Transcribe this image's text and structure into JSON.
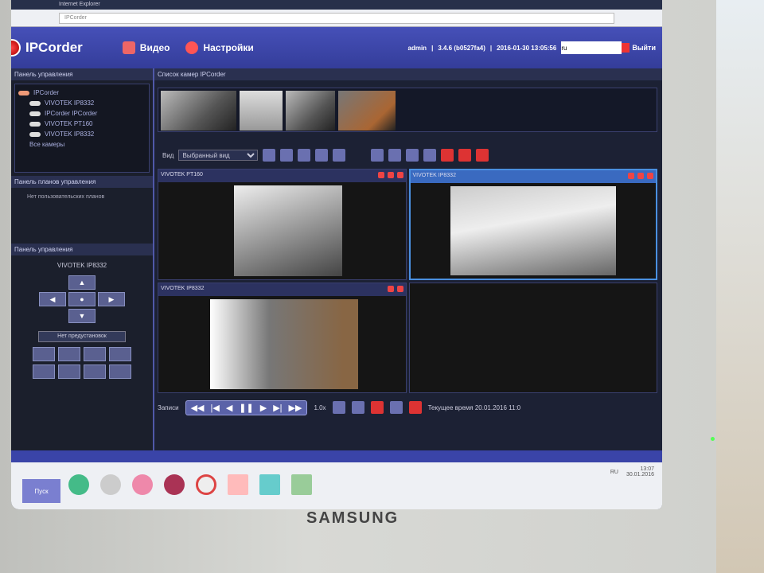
{
  "browser": {
    "tab": "Internet Explorer",
    "address": "IPCorder"
  },
  "header": {
    "logo": "IPCorder",
    "nav": [
      {
        "label": "Видео"
      },
      {
        "label": "Настройки"
      }
    ],
    "user": "admin",
    "version": "3.4.6 (b0527fa4)",
    "datetime": "2016-01-30 13:05:56",
    "input_value": "ru",
    "exit": "Выйти"
  },
  "left": {
    "tree_title": "Панель управления",
    "tree_header": "Все камеры",
    "tree_root": "IPCorder",
    "cameras": [
      "VIVOTEK IP8332",
      "IPCorder IPCorder",
      "VIVOTEK PT160",
      "VIVOTEK IP8332"
    ],
    "all_cameras": "Все камеры",
    "maps_title": "Панель планов управления",
    "maps_empty": "Нет пользовательских планов",
    "ptz_title": "Панель управления",
    "ptz_camera": "VIVOTEK IP8332",
    "preset": "Нет предустановок"
  },
  "main": {
    "strip_title": "Список камер IPCorder",
    "view_label": "Вид",
    "view_value": "Выбранный вид",
    "cells": [
      {
        "title": "VIVOTEK PT160"
      },
      {
        "title": "VIVOTEK IP8332"
      },
      {
        "title": "VIVOTEK IP8332"
      },
      {
        "title": ""
      }
    ],
    "control_label": "Записи",
    "speed": "1.0x",
    "status": "Текущее время 20.01.2016 11:0"
  },
  "taskbar": {
    "start": "Пуск",
    "clock_time": "13:07",
    "clock_date": "30.01.2016",
    "lang": "RU"
  },
  "monitor": {
    "brand": "SAMSUNG"
  }
}
